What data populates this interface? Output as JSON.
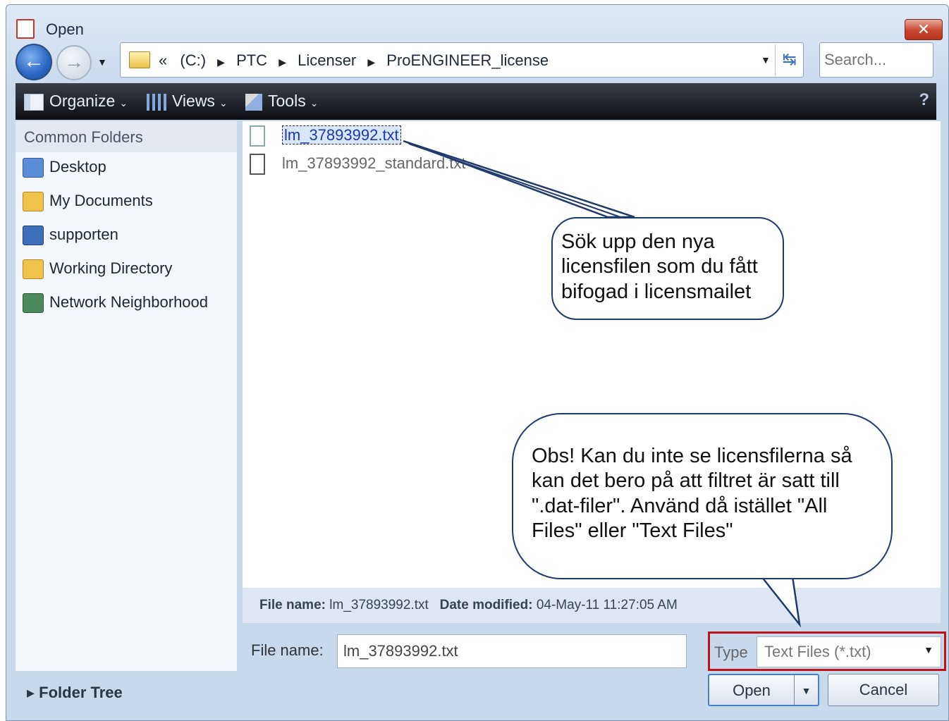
{
  "window": {
    "title": "Open",
    "close_glyph": "✕"
  },
  "nav": {
    "back_glyph": "←",
    "forward_glyph": "→",
    "dropdown_glyph": "▼",
    "breadcrumb": [
      "«",
      "(C:)",
      "PTC",
      "Licenser",
      "ProENGINEER_license"
    ],
    "breadcrumb_sep": "▶",
    "address_dropdown_glyph": "▼",
    "refresh_glyph": "↹"
  },
  "search": {
    "placeholder": "Search..."
  },
  "toolbar": {
    "organize": "Organize",
    "views": "Views",
    "tools": "Tools",
    "chevron": "⌄",
    "help": "?"
  },
  "sidebar": {
    "header": "Common Folders",
    "items": [
      {
        "label": "Desktop",
        "icon": "desktop-icon",
        "color": "#5b8dd6"
      },
      {
        "label": "My Documents",
        "icon": "my-documents-icon",
        "color": "#f0c44a"
      },
      {
        "label": "supporten",
        "icon": "computer-icon",
        "color": "#3c6fb8"
      },
      {
        "label": "Working Directory",
        "icon": "working-directory-icon",
        "color": "#f0c44a"
      },
      {
        "label": "Network Neighborhood",
        "icon": "network-icon",
        "color": "#4a8a5c"
      }
    ],
    "folder_tree": "▸ Folder Tree"
  },
  "files": [
    {
      "name": "lm_37893992.txt",
      "selected": true
    },
    {
      "name": "lm_37893992_standard.txt",
      "selected": false
    }
  ],
  "info": {
    "file_name_label": "File name:",
    "file_name_value": "lm_37893992.txt",
    "date_label": "Date modified:",
    "date_value": "04-May-11 11:27:05 AM"
  },
  "form": {
    "file_name_label": "File name:",
    "file_name_value": "lm_37893992.txt",
    "type_label": "Type",
    "type_value": "Text Files (*.txt)",
    "type_arrow": "▼"
  },
  "buttons": {
    "open": "Open",
    "open_split": "▼",
    "cancel": "Cancel"
  },
  "annotations": {
    "callout1": [
      "Sök upp den nya",
      "licensfilen som du fått",
      "bifogad i licensmailet"
    ],
    "callout2": [
      "Obs! Kan du inte se licensfilerna så",
      "kan det bero på att filtret är satt till",
      "\".dat-filer\". Använd då istället \"All",
      "Files\" eller \"Text Files\""
    ],
    "accent_color": "#1f3a6b",
    "highlight_color": "#c0141d"
  }
}
